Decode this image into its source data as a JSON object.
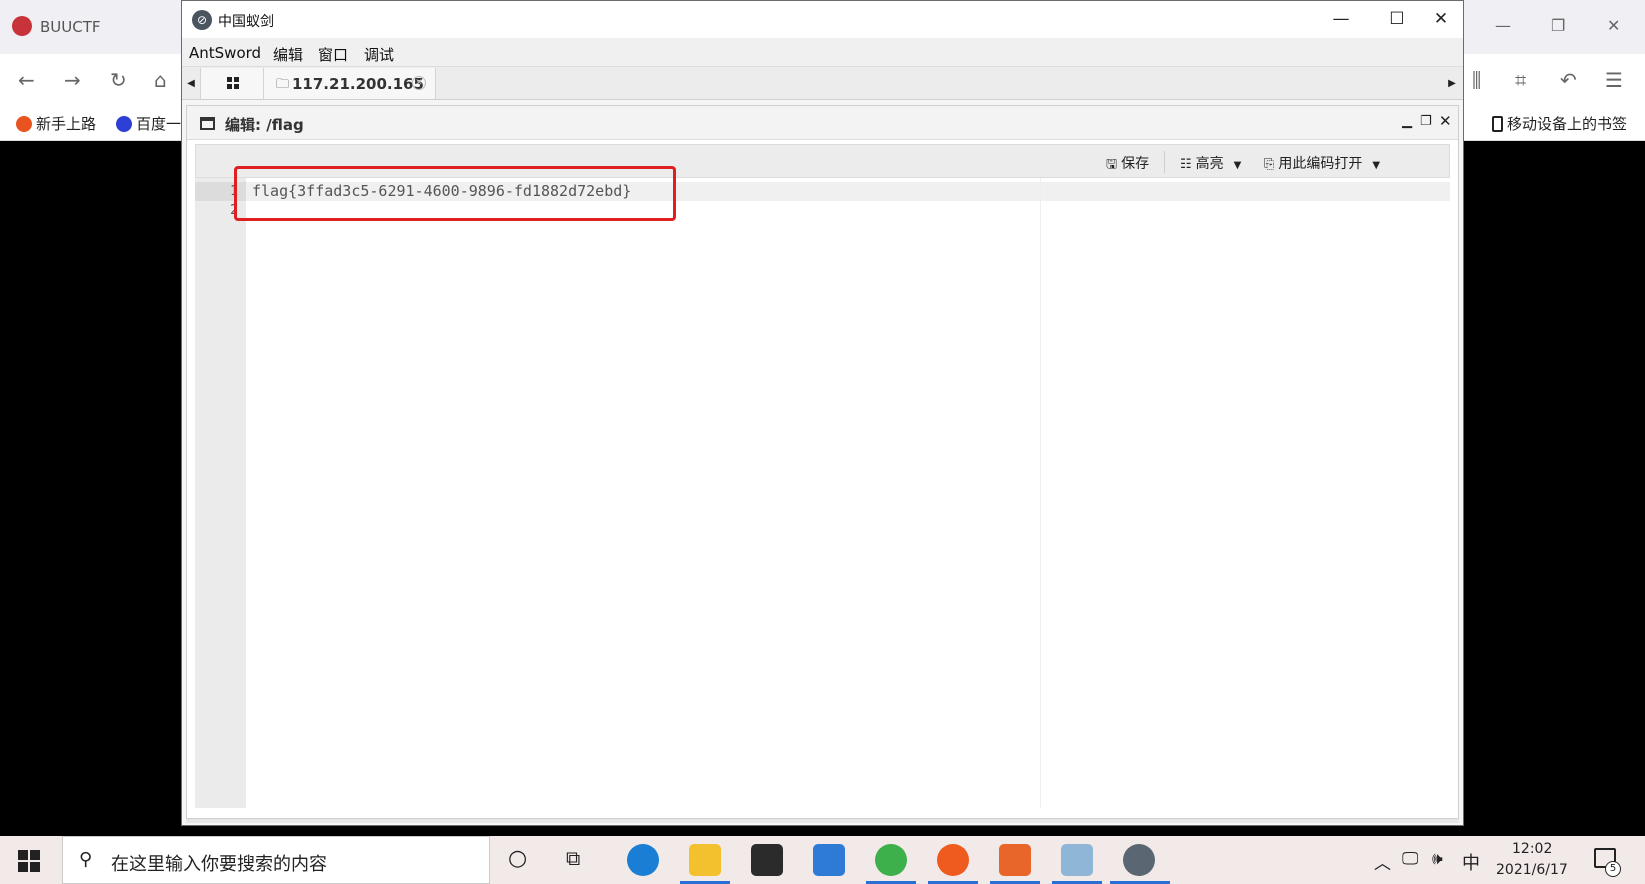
{
  "browser": {
    "tab_title": "BUUCTF",
    "bookmarks": [
      {
        "label": "新手上路"
      },
      {
        "label": "百度一"
      },
      {
        "label": "移动设备上的书签"
      }
    ]
  },
  "antsword": {
    "window_title": "中国蚁剑",
    "menu": [
      "AntSword",
      "编辑",
      "窗口",
      "调试"
    ],
    "tabs": {
      "host": "117.21.200.165"
    },
    "editor": {
      "title": "编辑: /flag",
      "toolbar": {
        "save_label": "保存",
        "highlight_label": "高亮",
        "encoding_label": "用此编码打开"
      },
      "lines": [
        {
          "number": "1",
          "text": "flag{3ffad3c5-6291-4600-9896-fd1882d72ebd}"
        },
        {
          "number": "2",
          "text": ""
        }
      ]
    }
  },
  "taskbar": {
    "search_placeholder": "在这里输入你要搜索的内容",
    "ime": "中",
    "time": "12:02",
    "date": "2021/6/17",
    "notification_count": "5"
  },
  "colors": {
    "highlight_box": "#e02020",
    "taskbar_active": "#2a6fd6"
  }
}
